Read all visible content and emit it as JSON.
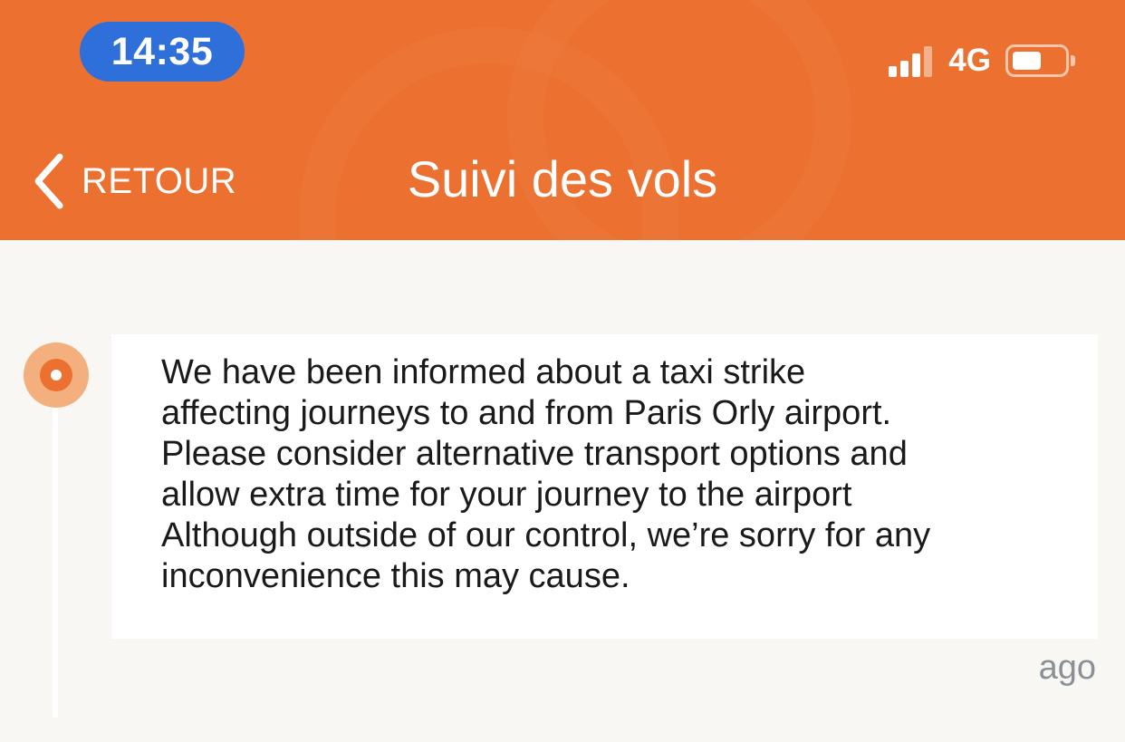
{
  "status_bar": {
    "time": "14:35",
    "network": "4G",
    "signal_bars": 3,
    "battery_level": 0.5
  },
  "nav": {
    "back_label": "RETOUR",
    "title": "Suivi des vols"
  },
  "colors": {
    "header": "#ec7131",
    "time_pill": "#2f6fd9",
    "background": "#f8f7f4",
    "timestamp": "#8a9096"
  },
  "icons": {
    "back": "chevron-left-icon",
    "timeline": "timeline-dot-icon",
    "signal": "signal-icon",
    "battery": "battery-icon"
  },
  "message": {
    "lines": [
      "We have been informed about a taxi strike",
      "affecting journeys to and from Paris Orly airport.",
      "Please consider alternative transport options and",
      "allow extra time for your journey to the airport",
      "Although outside of our control, we’re sorry for any",
      "inconvenience this may cause."
    ],
    "timestamp": "ago"
  }
}
